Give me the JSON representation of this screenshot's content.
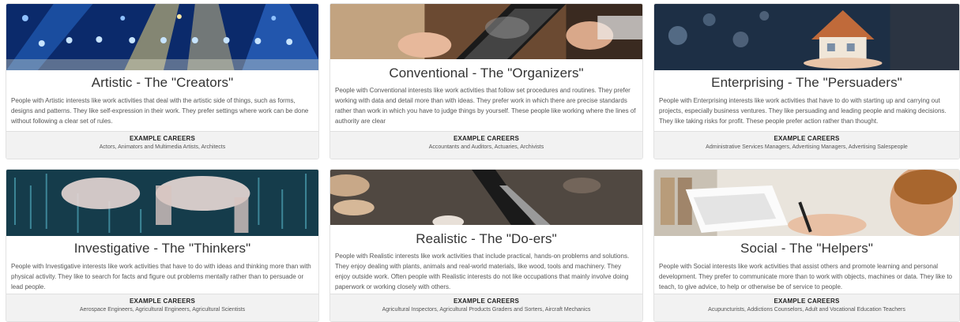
{
  "footer_heading": "EXAMPLE CAREERS",
  "cards": [
    {
      "title": "Artistic - The \"Creators\"",
      "description": "People with Artistic interests like work activities that deal with the artistic side of things, such as forms, designs and patterns. They like self-expression in their work. They prefer settings where work can be done without following a clear set of rules.",
      "careers": "Actors, Animators and Multimedia Artists, Architects"
    },
    {
      "title": "Conventional - The \"Organizers\"",
      "description": "People with Conventional interests like work activities that follow set procedures and routines. They prefer working with data and detail more than with ideas. They prefer work in which there are precise standards rather than work in which you have to judge things by yourself. These people like working where the lines of authority are clear",
      "careers": "Accountants and Auditors, Actuaries, Archivists"
    },
    {
      "title": "Enterprising - The \"Persuaders\"",
      "description": "People with Enterprising interests like work activities that have to do with starting up and carrying out projects, especially business ventures. They like persuading and leading people and making decisions. They like taking risks for profit. These people prefer action rather than thought.",
      "careers": "Administrative Services Managers, Advertising Managers, Advertising Salespeople"
    },
    {
      "title": "Investigative - The \"Thinkers\"",
      "description": "People with Investigative interests like work activities that have to do with ideas and thinking more than with physical activity. They like to search for facts and figure out problems mentally rather than to persuade or lead people.",
      "careers": "Aerospace Engineers, Agricultural Engineers, Agricultural Scientists"
    },
    {
      "title": "Realistic - The \"Do-ers\"",
      "description": "People with Realistic interests like work activities that include practical, hands-on problems and solutions. They enjoy dealing with plants, animals and real-world materials, like wood, tools and machinery. They enjoy outside work. Often people with Realistic interests do not like occupations that mainly involve doing paperwork or working closely with others.",
      "careers": "Agricultural Inspectors, Agricultural Products Graders and Sorters, Aircraft Mechanics"
    },
    {
      "title": "Social - The \"Helpers\"",
      "description": "People with Social interests like work activities that assist others and promote learning and personal development. They prefer to communicate more than to work with objects, machines or data. They like to teach, to give advice, to help or otherwise be of service to people.",
      "careers": "Acupuncturists, Addictions Counselors, Adult and Vocational Education Teachers"
    }
  ]
}
